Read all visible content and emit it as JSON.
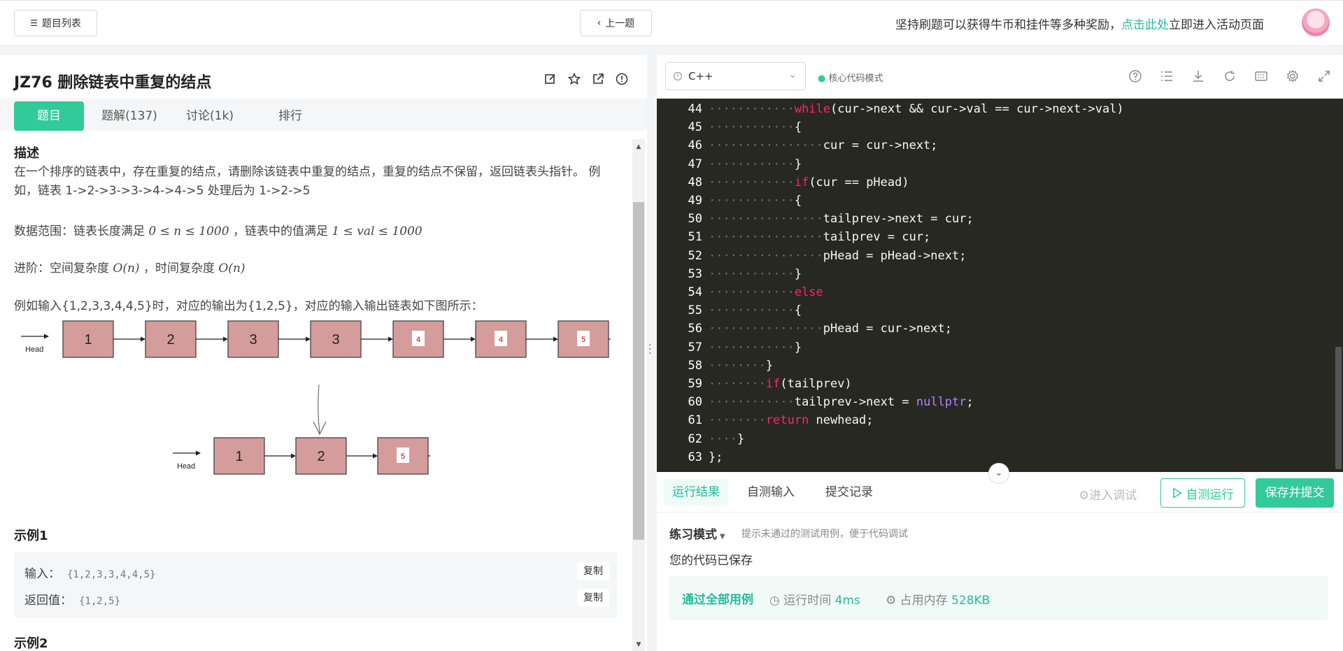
{
  "topbar": {
    "problem_list_icon": "list-icon",
    "problem_list_label": "题目列表",
    "prev_icon": "chevron-left-icon",
    "prev_label": "上一题",
    "promo_before": "坚持刷题可以获得牛币和挂件等多种奖励，",
    "promo_link": "点击此处",
    "promo_after": "立即进入活动页面"
  },
  "problem": {
    "title": "JZ76  删除链表中重复的结点",
    "title_icons": [
      "edit-icon",
      "star-icon",
      "external-link-icon",
      "info-icon"
    ],
    "tabs": [
      {
        "label": "题目",
        "active": true
      },
      {
        "label": "题解(137)",
        "active": false
      },
      {
        "label": "讨论(1k)",
        "active": false
      },
      {
        "label": "排行",
        "active": false
      }
    ],
    "desc_heading": "描述",
    "desc": "在一个排序的链表中，存在重复的结点，请删除该链表中重复的结点，重复的结点不保留，返回链表头指针。 例如，链表 1->2->3->3->4->4->5 处理后为 1->2->5",
    "range_prefix": "数据范围：链表长度满足 ",
    "range_math1": "0 ≤ n ≤ 1000",
    "range_mid": " ，链表中的值满足 ",
    "range_math2": "1 ≤ val ≤ 1000",
    "adv_prefix": "进阶：空间复杂度 ",
    "adv_math1": "O(n)",
    "adv_mid": " ，时间复杂度 ",
    "adv_math2": "O(n)",
    "example_text": "例如输入{1,2,3,3,4,4,5}时，对应的输出为{1,2,5}，对应的输入输出链表如下图所示：",
    "diagram": {
      "head_label": "Head",
      "input_nodes": [
        "1",
        "2",
        "3",
        "3",
        "4",
        "4",
        "5"
      ],
      "output_nodes": [
        "1",
        "2",
        "5"
      ]
    },
    "example1_heading": "示例1",
    "example1": {
      "input_label": "输入：",
      "input_value": "{1,2,3,3,4,4,5}",
      "output_label": "返回值：",
      "output_value": "{1,2,5}",
      "copy_label": "复制"
    },
    "example2_heading": "示例2"
  },
  "editor": {
    "language": "C++",
    "mode_label": "核心代码模式",
    "tool_icons": [
      "help-icon",
      "list-icon",
      "download-icon",
      "refresh-icon",
      "keyboard-icon",
      "settings-icon",
      "fullscreen-icon"
    ],
    "lines": [
      {
        "n": "44",
        "d": "············",
        "html": "<span class=\"kw\">while</span>(cur->next && cur->val == cur->next->val)"
      },
      {
        "n": "45",
        "d": "············",
        "html": "{"
      },
      {
        "n": "46",
        "d": "················",
        "html": "cur = cur->next;"
      },
      {
        "n": "47",
        "d": "············",
        "html": "}"
      },
      {
        "n": "48",
        "d": "············",
        "html": "<span class=\"kw\">if</span>(cur == pHead)"
      },
      {
        "n": "49",
        "d": "············",
        "html": "{"
      },
      {
        "n": "50",
        "d": "················",
        "html": "tailprev->next = cur;"
      },
      {
        "n": "51",
        "d": "················",
        "html": "tailprev = cur;"
      },
      {
        "n": "52",
        "d": "················",
        "html": "pHead = pHead->next;"
      },
      {
        "n": "53",
        "d": "············",
        "html": "}"
      },
      {
        "n": "54",
        "d": "············",
        "html": "<span class=\"kw\">else</span>"
      },
      {
        "n": "55",
        "d": "············",
        "html": "{"
      },
      {
        "n": "56",
        "d": "················",
        "html": "pHead = cur->next;"
      },
      {
        "n": "57",
        "d": "············",
        "html": "}"
      },
      {
        "n": "58",
        "d": "········",
        "html": "}"
      },
      {
        "n": "59",
        "d": "········",
        "html": "<span class=\"kw\">if</span>(tailprev)"
      },
      {
        "n": "60",
        "d": "············",
        "html": "tailprev->next = <span class=\"kw2\">nullptr</span>;"
      },
      {
        "n": "61",
        "d": "········",
        "html": "<span class=\"kw\">return</span> newhead;"
      },
      {
        "n": "62",
        "d": "····",
        "html": "}"
      },
      {
        "n": "63",
        "d": "",
        "html": "};"
      }
    ]
  },
  "results": {
    "tabs": [
      {
        "label": "运行结果",
        "active": true
      },
      {
        "label": "自测输入",
        "active": false
      },
      {
        "label": "提交记录",
        "active": false
      }
    ],
    "debug_label": "进入调试",
    "run_label": "自测运行",
    "submit_label": "保存并提交",
    "practice_label": "练习模式",
    "practice_hint": "提示未通过的测试用例，便于代码调试",
    "saved_msg": "您的代码已保存",
    "pass_label": "通过全部用例",
    "runtime_label": "运行时间",
    "runtime_value": "4ms",
    "memory_label": "占用内存",
    "memory_value": "528KB"
  },
  "colors": {
    "accent": "#32ca99",
    "link": "#25bb9b",
    "editor_bg": "#272822",
    "node_fill": "#d59c9c"
  }
}
